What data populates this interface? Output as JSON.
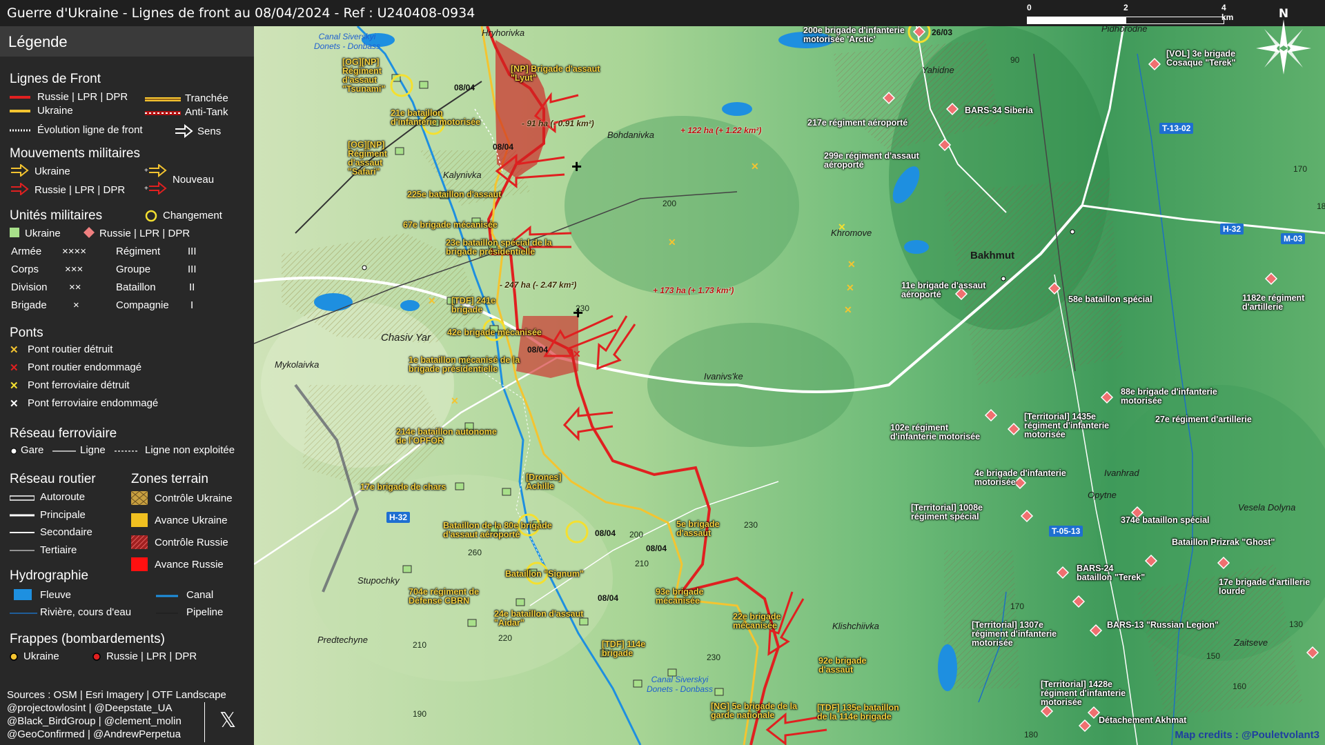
{
  "title": "Guerre d'Ukraine - Lignes de front au 08/04/2024 - Ref : U240408-0934",
  "scale": {
    "labels": [
      "0",
      "2",
      "4 km"
    ]
  },
  "north": "N",
  "legend": {
    "title": "Légende",
    "front": {
      "title": "Lignes de Front",
      "russia": "Russie | LPR | DPR",
      "ukraine": "Ukraine",
      "evolution": "Évolution ligne de front",
      "trench": "Tranchée",
      "antitank": "Anti-Tank",
      "sens": "Sens"
    },
    "moves": {
      "title": "Mouvements militaires",
      "ukraine": "Ukraine",
      "russia": "Russie | LPR | DPR",
      "new": "Nouveau"
    },
    "units": {
      "title": "Unités militaires",
      "change": "Changement",
      "ukraine": "Ukraine",
      "russia": "Russie | LPR | DPR",
      "rows": [
        {
          "a": "Armée",
          "as": "××××",
          "b": "Régiment",
          "bs": "III"
        },
        {
          "a": "Corps",
          "as": "×××",
          "b": "Groupe",
          "bs": "III"
        },
        {
          "a": "Division",
          "as": "××",
          "b": "Bataillon",
          "bs": "II"
        },
        {
          "a": "Brigade",
          "as": "×",
          "b": "Compagnie",
          "bs": "I"
        }
      ]
    },
    "bridges": {
      "title": "Ponts",
      "items": [
        "Pont routier détruit",
        "Pont routier endommagé",
        "Pont ferroviaire détruit",
        "Pont ferroviaire endommagé"
      ],
      "colors": [
        "#f4c430",
        "#e02020",
        "#f4e030",
        "#ffffff"
      ]
    },
    "rail": {
      "title": "Réseau ferroviaire",
      "station": "Gare",
      "line": "Ligne",
      "unused": "Ligne non exploitée"
    },
    "roads": {
      "title": "Réseau routier",
      "items": [
        "Autoroute",
        "Principale",
        "Secondaire",
        "Tertiaire"
      ]
    },
    "zones": {
      "title": "Zones terrain",
      "items": [
        "Contrôle Ukraine",
        "Avance Ukraine",
        "Contrôle Russie",
        "Avance Russie"
      ]
    },
    "hydro": {
      "title": "Hydrographie",
      "fleuve": "Fleuve",
      "canal": "Canal",
      "river": "Rivière, cours d'eau",
      "pipeline": "Pipeline"
    },
    "strikes": {
      "title": "Frappes (bombardements)",
      "ukraine": "Ukraine",
      "russia": "Russie | LPR | DPR"
    },
    "sources": [
      "Sources : OSM | Esri Imagery | OTF Landscape",
      "@projectowlosint | @Deepstate_UA",
      "@Black_BirdGroup | @clement_molin",
      "@GeoConfirmed | @AndrewPerpetua"
    ]
  },
  "colors": {
    "ukraine": "#f4c430",
    "russia": "#d42020",
    "map_light": "#b8dba0",
    "map_dark": "#3f9a5a"
  },
  "places": [
    "Hryhorivka",
    "Bohdanivka",
    "Kalynivka",
    "Chasiv Yar",
    "Mykolaivka",
    "Ivanivs'ke",
    "Khromove",
    "Bakhmut",
    "Yahidne",
    "Ivanhrad",
    "Opytne",
    "Vesela Dolyna",
    "Klishchiivka",
    "Stupochky",
    "Predtechyne",
    "Zaitseve",
    "Pidhorodne"
  ],
  "canal": "Canal Siverskyi Donets - Donbass",
  "roads_labels": [
    "H-32",
    "T-13-02",
    "H-32",
    "M-03",
    "T-05-13"
  ],
  "gains": [
    "- 91 ha (- 0.91 km²)",
    "+ 122 ha (+ 1.22 km²)",
    "- 247 ha (- 2.47 km²)",
    "+ 173 ha (+ 1.73 km²)"
  ],
  "dates": [
    "08/04",
    "08/04",
    "08/04",
    "08/04",
    "08/04",
    "08/04",
    "26/03"
  ],
  "elevations": [
    "90",
    "170",
    "200",
    "230",
    "200",
    "230",
    "210",
    "260",
    "210",
    "220",
    "230",
    "170",
    "150",
    "160",
    "130",
    "190",
    "180",
    "18"
  ],
  "ua_units": [
    "[OG][NP] Régiment d'assaut \"Tsunami\"",
    "[NP] Brigade d'assaut \"Lyut\"",
    "21e bataillon d'infanterie motorisée",
    "[OG][NP] Régiment d'assaut \"Safari\"",
    "225e bataillon d'assaut",
    "67e brigade mécanisée",
    "23e bataillon spécial de la brigade présidentielle",
    "[TDF] 241e brigade",
    "42e brigade mécanisée",
    "1e bataillon mécanisé de la brigade présidentielle",
    "214e bataillon autonome de l'OPFOR",
    "17e brigade de chars",
    "[Drones] Achille",
    "Bataillon de la 80e brigade d'assaut aéroporté",
    "5e brigade d'assaut",
    "Bataillon \"Signum\"",
    "704e régiment de Défense CBRN",
    "24e bataillon d'assaut \"Aidar\"",
    "93e brigade mécanisée",
    "22e brigade mécanisée",
    "[TDF] 114e brigade",
    "[NG] 5e brigade de la garde nationale",
    "92e brigade d'assaut",
    "[TDF] 135e bataillon de la 114e brigade"
  ],
  "ru_units": [
    "200e brigade d'infanterie motorisée 'Arctic'",
    "[VOL] 3e brigade Cosaque \"Terek\"",
    "BARS-34 Siberia",
    "217e régiment aéroporté",
    "299e régiment d'assaut aéroporté",
    "11e brigade d'assaut aéroporté",
    "58e bataillon spécial",
    "1182e régiment d'artillerie",
    "102e régiment d'infanterie motorisée",
    "[Territorial] 1435e régiment d'infanterie motorisée",
    "88e brigade d'infanterie motorisée",
    "27e régiment d'artillerie",
    "4e brigade d'infanterie motorisée",
    "[Territorial] 1008e régiment spécial",
    "374e bataillon spécial",
    "Bataillon Prizrak \"Ghost\"",
    "BARS-24 bataillon \"Terek\"",
    "17e brigade d'artillerie lourde",
    "[Territorial] 1307e régiment d'infanterie motorisée",
    "BARS-13 \"Russian Legion\"",
    "[Territorial] 1428e régiment d'infanterie motorisée",
    "Détachement Akhmat"
  ],
  "credits": "Map credits : @Pouletvolant3"
}
